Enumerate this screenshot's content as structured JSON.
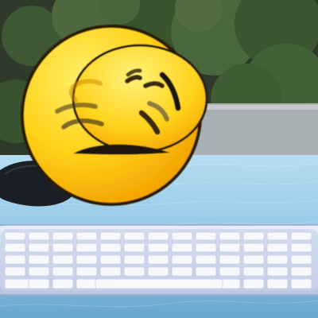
{
  "scene": {
    "description_tags": [
      "garden-background",
      "towel-surface",
      "computer-mouse",
      "keyboard",
      "emoji-sticker"
    ],
    "colors": {
      "foliage_dark": "#2f3a2a",
      "foliage_mid": "#4f6b3f",
      "wall": "#a8b0b4",
      "towel": "#8fc6e6",
      "towel_shadow": "#6aa7cc",
      "keyboard_body": "#d5dceb",
      "keycap": "#f7f8fb",
      "mouse": "#1c1f26",
      "emoji_yellow": "#ffd21a",
      "emoji_orange": "#f2a100",
      "emoji_outline": "#2a1a00"
    }
  }
}
